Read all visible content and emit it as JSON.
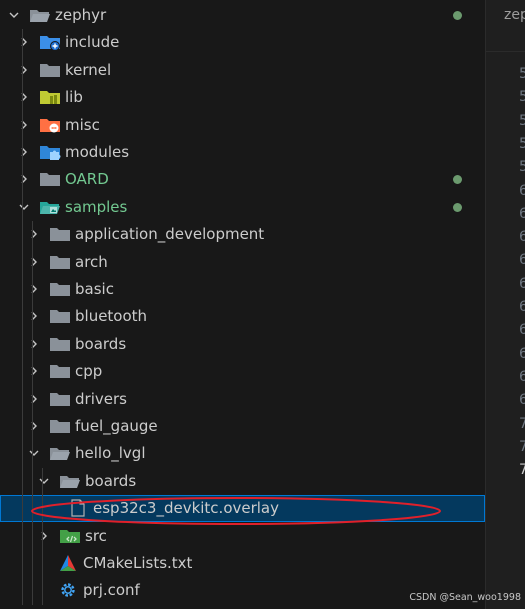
{
  "explorer": {
    "rows": [
      {
        "name": "folder-zephyr",
        "label": "zephyr",
        "depth": 0,
        "expanded": true,
        "icon": "folder-open-icon",
        "git_dot": true
      },
      {
        "name": "folder-include",
        "label": "include",
        "depth": 1,
        "expanded": false,
        "icon": "folder-include-icon"
      },
      {
        "name": "folder-kernel",
        "label": "kernel",
        "depth": 1,
        "expanded": false,
        "icon": "folder-icon"
      },
      {
        "name": "folder-lib",
        "label": "lib",
        "depth": 1,
        "expanded": false,
        "icon": "folder-lib-icon"
      },
      {
        "name": "folder-misc",
        "label": "misc",
        "depth": 1,
        "expanded": false,
        "icon": "folder-misc-icon"
      },
      {
        "name": "folder-modules",
        "label": "modules",
        "depth": 1,
        "expanded": false,
        "icon": "folder-modules-icon"
      },
      {
        "name": "folder-oard",
        "label": "OARD",
        "depth": 1,
        "expanded": false,
        "icon": "folder-icon",
        "git_dot": true,
        "status": "untracked"
      },
      {
        "name": "folder-samples",
        "label": "samples",
        "depth": 1,
        "expanded": true,
        "icon": "folder-samples-open-icon",
        "git_dot": true,
        "status": "untracked"
      },
      {
        "name": "folder-application-development",
        "label": "application_development",
        "depth": 2,
        "expanded": false,
        "icon": "folder-icon"
      },
      {
        "name": "folder-arch",
        "label": "arch",
        "depth": 2,
        "expanded": false,
        "icon": "folder-icon"
      },
      {
        "name": "folder-basic",
        "label": "basic",
        "depth": 2,
        "expanded": false,
        "icon": "folder-icon"
      },
      {
        "name": "folder-bluetooth",
        "label": "bluetooth",
        "depth": 2,
        "expanded": false,
        "icon": "folder-icon"
      },
      {
        "name": "folder-boards",
        "label": "boards",
        "depth": 2,
        "expanded": false,
        "icon": "folder-icon"
      },
      {
        "name": "folder-cpp",
        "label": "cpp",
        "depth": 2,
        "expanded": false,
        "icon": "folder-icon"
      },
      {
        "name": "folder-drivers",
        "label": "drivers",
        "depth": 2,
        "expanded": false,
        "icon": "folder-icon"
      },
      {
        "name": "folder-fuel-gauge",
        "label": "fuel_gauge",
        "depth": 2,
        "expanded": false,
        "icon": "folder-icon"
      },
      {
        "name": "folder-hello-lvgl",
        "label": "hello_lvgl",
        "depth": 2,
        "expanded": true,
        "icon": "folder-open-icon"
      },
      {
        "name": "folder-hello-lvgl-boards",
        "label": "boards",
        "depth": 3,
        "expanded": true,
        "icon": "folder-open-icon"
      },
      {
        "name": "file-esp32c3-devkitc-overlay",
        "label": "esp32c3_devkitc.overlay",
        "depth": 4,
        "file": true,
        "icon": "file-icon",
        "selected": true
      },
      {
        "name": "folder-src",
        "label": "src",
        "depth": 3,
        "expanded": false,
        "icon": "folder-src-icon"
      },
      {
        "name": "file-cmakelists",
        "label": "CMakeLists.txt",
        "depth": 3,
        "file": true,
        "icon": "cmake-icon"
      },
      {
        "name": "file-prj-conf",
        "label": "prj.conf",
        "depth": 3,
        "file": true,
        "icon": "gear-icon"
      }
    ]
  },
  "editor": {
    "tab_label": "zep",
    "line_numbers": [
      "5",
      "5",
      "5",
      "5",
      "5",
      "6",
      "6",
      "6",
      "6",
      "6",
      "6",
      "6",
      "6",
      "6",
      "6",
      "7",
      "7",
      "7"
    ],
    "active_line_index": 17
  },
  "watermark": "CSDN @Sean_woo1998",
  "colors": {
    "background": "#181818",
    "selection": "#04395e",
    "selection_border": "#0078d4",
    "untracked": "#73c991",
    "annotation_oval": "#e0202a"
  }
}
